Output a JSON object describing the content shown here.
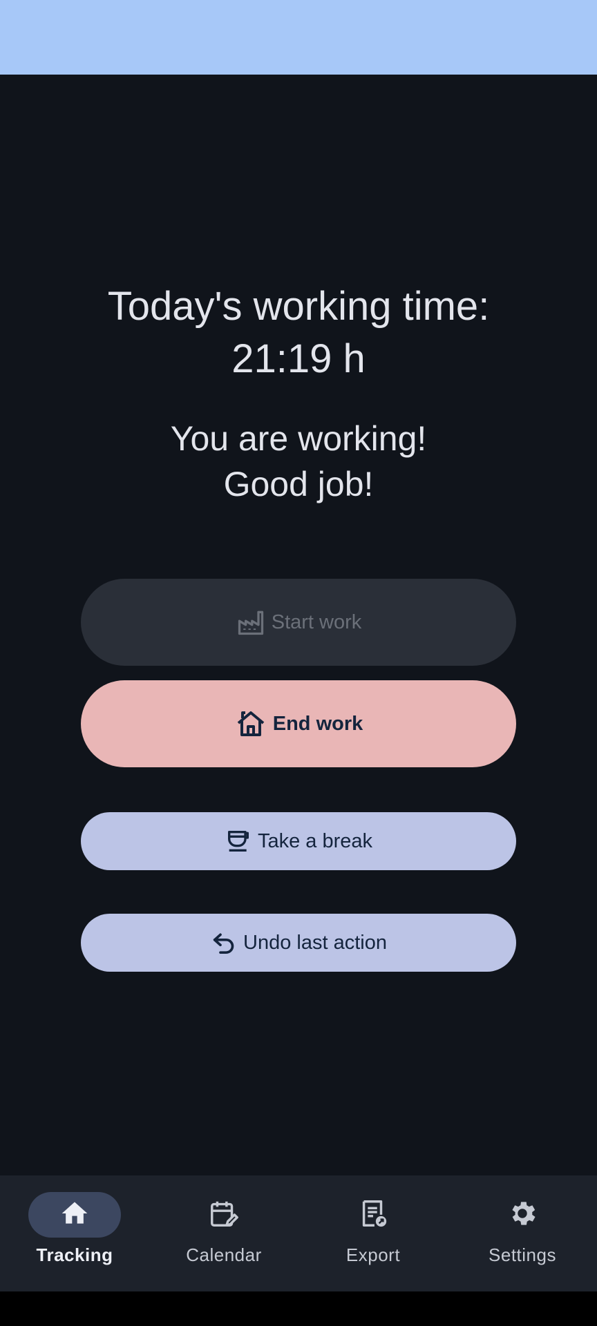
{
  "title": {
    "line1": "Today's working time:",
    "line2": "21:19 h"
  },
  "status_message": {
    "line1": "You are working!",
    "line2": "Good job!"
  },
  "actions": {
    "start_label": "Start work",
    "end_label": "End work",
    "break_label": "Take a break",
    "undo_label": "Undo last action"
  },
  "nav": {
    "tracking": "Tracking",
    "calendar": "Calendar",
    "export": "Export",
    "settings": "Settings"
  },
  "icons": {
    "start": "factory-icon",
    "end": "home-outline-icon",
    "break": "coffee-cup-icon",
    "undo": "undo-icon",
    "tracking": "home-icon",
    "calendar": "calendar-edit-icon",
    "export": "export-document-icon",
    "settings": "gear-icon"
  },
  "colors": {
    "status_bar": "#a7c8f8",
    "background": "#10141b",
    "start_button_disabled": "#2a2f38",
    "end_button": "#e9b6b6",
    "secondary_button": "#bcc4e6",
    "nav_background": "#1d222b",
    "nav_active_pill": "#3c4760"
  }
}
